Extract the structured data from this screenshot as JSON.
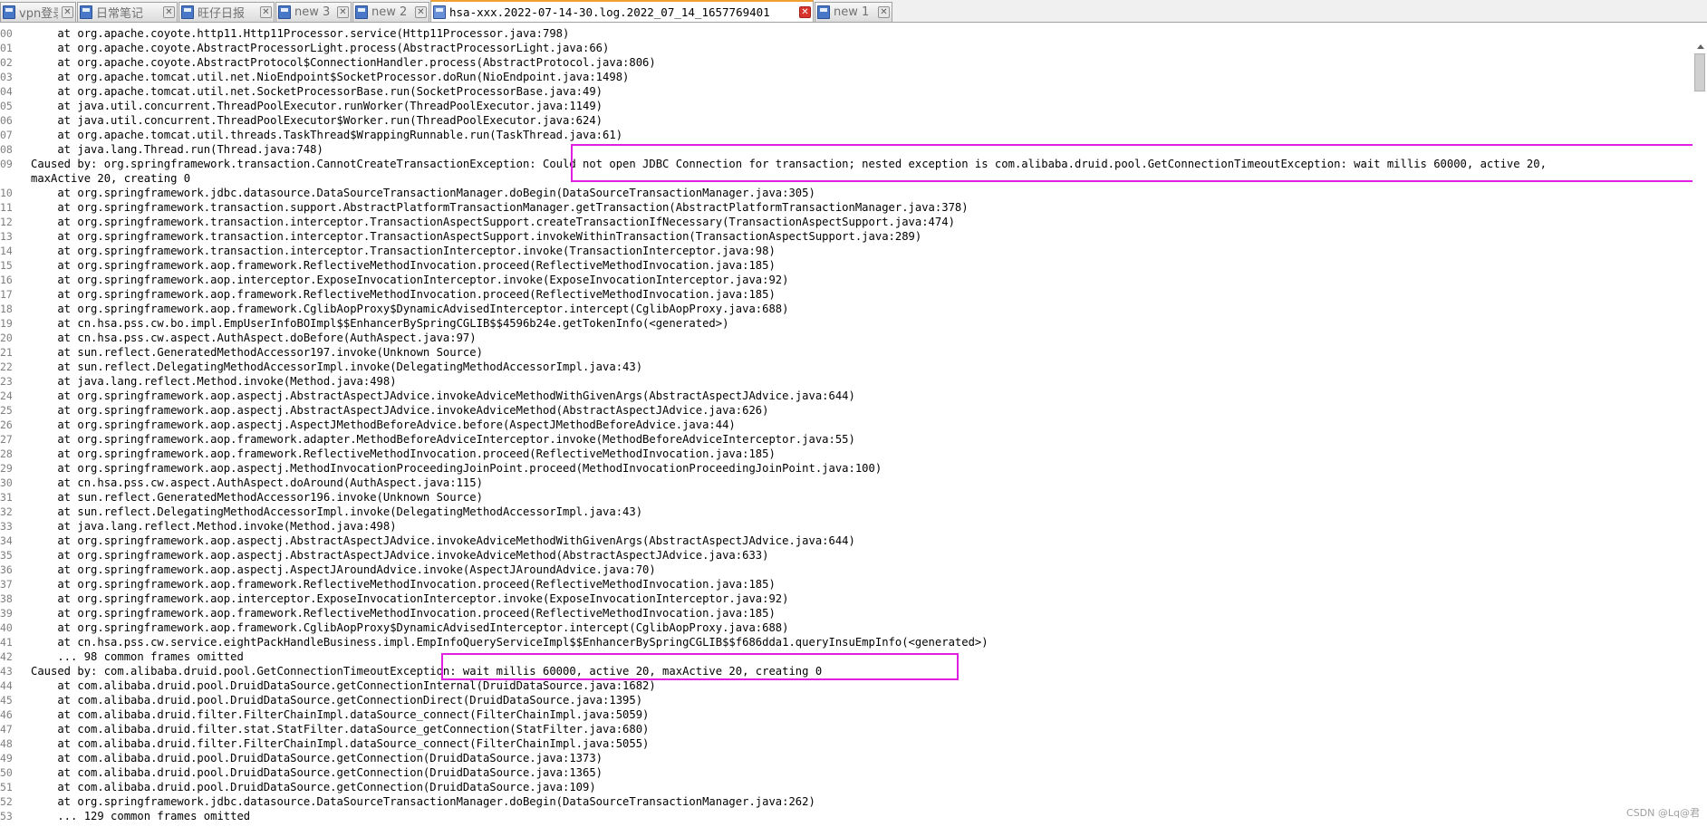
{
  "tabs": [
    {
      "label": "vpn登录",
      "active": false
    },
    {
      "label": "日常笔记",
      "active": false
    },
    {
      "label": "旺仔日报",
      "active": false
    },
    {
      "label": "new 3",
      "active": false
    },
    {
      "label": "new 2",
      "active": false
    },
    {
      "label": "hsa-xxx.2022-07-14-30.log.2022_07_14_1657769401",
      "active": true
    },
    {
      "label": "new 1",
      "active": false
    }
  ],
  "colors": {
    "highlight": "#e020e0",
    "active_tab_accent": "#f0a030"
  },
  "lines": [
    {
      "n": "00",
      "text": "    at org.apache.coyote.http11.Http11Processor.service(Http11Processor.java:798)"
    },
    {
      "n": "01",
      "text": "    at org.apache.coyote.AbstractProcessorLight.process(AbstractProcessorLight.java:66)"
    },
    {
      "n": "02",
      "text": "    at org.apache.coyote.AbstractProtocol$ConnectionHandler.process(AbstractProtocol.java:806)"
    },
    {
      "n": "03",
      "text": "    at org.apache.tomcat.util.net.NioEndpoint$SocketProcessor.doRun(NioEndpoint.java:1498)"
    },
    {
      "n": "04",
      "text": "    at org.apache.tomcat.util.net.SocketProcessorBase.run(SocketProcessorBase.java:49)"
    },
    {
      "n": "05",
      "text": "    at java.util.concurrent.ThreadPoolExecutor.runWorker(ThreadPoolExecutor.java:1149)"
    },
    {
      "n": "06",
      "text": "    at java.util.concurrent.ThreadPoolExecutor$Worker.run(ThreadPoolExecutor.java:624)"
    },
    {
      "n": "07",
      "text": "    at org.apache.tomcat.util.threads.TaskThread$WrappingRunnable.run(TaskThread.java:61)"
    },
    {
      "n": "08",
      "text": "    at java.lang.Thread.run(Thread.java:748)"
    },
    {
      "n": "09",
      "text": "Caused by: org.springframework.transaction.CannotCreateTransactionException: Could not open JDBC Connection for transaction; nested exception is com.alibaba.druid.pool.GetConnectionTimeoutException: wait millis 60000, active 20,"
    },
    {
      "n": "",
      "text": "maxActive 20, creating 0"
    },
    {
      "n": "10",
      "text": "    at org.springframework.jdbc.datasource.DataSourceTransactionManager.doBegin(DataSourceTransactionManager.java:305)"
    },
    {
      "n": "11",
      "text": "    at org.springframework.transaction.support.AbstractPlatformTransactionManager.getTransaction(AbstractPlatformTransactionManager.java:378)"
    },
    {
      "n": "12",
      "text": "    at org.springframework.transaction.interceptor.TransactionAspectSupport.createTransactionIfNecessary(TransactionAspectSupport.java:474)"
    },
    {
      "n": "13",
      "text": "    at org.springframework.transaction.interceptor.TransactionAspectSupport.invokeWithinTransaction(TransactionAspectSupport.java:289)"
    },
    {
      "n": "14",
      "text": "    at org.springframework.transaction.interceptor.TransactionInterceptor.invoke(TransactionInterceptor.java:98)"
    },
    {
      "n": "15",
      "text": "    at org.springframework.aop.framework.ReflectiveMethodInvocation.proceed(ReflectiveMethodInvocation.java:185)"
    },
    {
      "n": "16",
      "text": "    at org.springframework.aop.interceptor.ExposeInvocationInterceptor.invoke(ExposeInvocationInterceptor.java:92)"
    },
    {
      "n": "17",
      "text": "    at org.springframework.aop.framework.ReflectiveMethodInvocation.proceed(ReflectiveMethodInvocation.java:185)"
    },
    {
      "n": "18",
      "text": "    at org.springframework.aop.framework.CglibAopProxy$DynamicAdvisedInterceptor.intercept(CglibAopProxy.java:688)"
    },
    {
      "n": "19",
      "text": "    at cn.hsa.pss.cw.bo.impl.EmpUserInfoBOImpl$$EnhancerBySpringCGLIB$$4596b24e.getTokenInfo(<generated>)"
    },
    {
      "n": "20",
      "text": "    at cn.hsa.pss.cw.aspect.AuthAspect.doBefore(AuthAspect.java:97)"
    },
    {
      "n": "21",
      "text": "    at sun.reflect.GeneratedMethodAccessor197.invoke(Unknown Source)"
    },
    {
      "n": "22",
      "text": "    at sun.reflect.DelegatingMethodAccessorImpl.invoke(DelegatingMethodAccessorImpl.java:43)"
    },
    {
      "n": "23",
      "text": "    at java.lang.reflect.Method.invoke(Method.java:498)"
    },
    {
      "n": "24",
      "text": "    at org.springframework.aop.aspectj.AbstractAspectJAdvice.invokeAdviceMethodWithGivenArgs(AbstractAspectJAdvice.java:644)"
    },
    {
      "n": "25",
      "text": "    at org.springframework.aop.aspectj.AbstractAspectJAdvice.invokeAdviceMethod(AbstractAspectJAdvice.java:626)"
    },
    {
      "n": "26",
      "text": "    at org.springframework.aop.aspectj.AspectJMethodBeforeAdvice.before(AspectJMethodBeforeAdvice.java:44)"
    },
    {
      "n": "27",
      "text": "    at org.springframework.aop.framework.adapter.MethodBeforeAdviceInterceptor.invoke(MethodBeforeAdviceInterceptor.java:55)"
    },
    {
      "n": "28",
      "text": "    at org.springframework.aop.framework.ReflectiveMethodInvocation.proceed(ReflectiveMethodInvocation.java:185)"
    },
    {
      "n": "29",
      "text": "    at org.springframework.aop.aspectj.MethodInvocationProceedingJoinPoint.proceed(MethodInvocationProceedingJoinPoint.java:100)"
    },
    {
      "n": "30",
      "text": "    at cn.hsa.pss.cw.aspect.AuthAspect.doAround(AuthAspect.java:115)"
    },
    {
      "n": "31",
      "text": "    at sun.reflect.GeneratedMethodAccessor196.invoke(Unknown Source)"
    },
    {
      "n": "32",
      "text": "    at sun.reflect.DelegatingMethodAccessorImpl.invoke(DelegatingMethodAccessorImpl.java:43)"
    },
    {
      "n": "33",
      "text": "    at java.lang.reflect.Method.invoke(Method.java:498)"
    },
    {
      "n": "34",
      "text": "    at org.springframework.aop.aspectj.AbstractAspectJAdvice.invokeAdviceMethodWithGivenArgs(AbstractAspectJAdvice.java:644)"
    },
    {
      "n": "35",
      "text": "    at org.springframework.aop.aspectj.AbstractAspectJAdvice.invokeAdviceMethod(AbstractAspectJAdvice.java:633)"
    },
    {
      "n": "36",
      "text": "    at org.springframework.aop.aspectj.AspectJAroundAdvice.invoke(AspectJAroundAdvice.java:70)"
    },
    {
      "n": "37",
      "text": "    at org.springframework.aop.framework.ReflectiveMethodInvocation.proceed(ReflectiveMethodInvocation.java:185)"
    },
    {
      "n": "38",
      "text": "    at org.springframework.aop.interceptor.ExposeInvocationInterceptor.invoke(ExposeInvocationInterceptor.java:92)"
    },
    {
      "n": "39",
      "text": "    at org.springframework.aop.framework.ReflectiveMethodInvocation.proceed(ReflectiveMethodInvocation.java:185)"
    },
    {
      "n": "40",
      "text": "    at org.springframework.aop.framework.CglibAopProxy$DynamicAdvisedInterceptor.intercept(CglibAopProxy.java:688)"
    },
    {
      "n": "41",
      "text": "    at cn.hsa.pss.cw.service.eightPackHandleBusiness.impl.EmpInfoQueryServiceImpl$$EnhancerBySpringCGLIB$$f686dda1.queryInsuEmpInfo(<generated>)"
    },
    {
      "n": "42",
      "text": "    ... 98 common frames omitted"
    },
    {
      "n": "43",
      "text": "Caused by: com.alibaba.druid.pool.GetConnectionTimeoutException: wait millis 60000, active 20, maxActive 20, creating 0"
    },
    {
      "n": "44",
      "text": "    at com.alibaba.druid.pool.DruidDataSource.getConnectionInternal(DruidDataSource.java:1682)"
    },
    {
      "n": "45",
      "text": "    at com.alibaba.druid.pool.DruidDataSource.getConnectionDirect(DruidDataSource.java:1395)"
    },
    {
      "n": "46",
      "text": "    at com.alibaba.druid.filter.FilterChainImpl.dataSource_connect(FilterChainImpl.java:5059)"
    },
    {
      "n": "47",
      "text": "    at com.alibaba.druid.filter.stat.StatFilter.dataSource_getConnection(StatFilter.java:680)"
    },
    {
      "n": "48",
      "text": "    at com.alibaba.druid.filter.FilterChainImpl.dataSource_connect(FilterChainImpl.java:5055)"
    },
    {
      "n": "49",
      "text": "    at com.alibaba.druid.pool.DruidDataSource.getConnection(DruidDataSource.java:1373)"
    },
    {
      "n": "50",
      "text": "    at com.alibaba.druid.pool.DruidDataSource.getConnection(DruidDataSource.java:1365)"
    },
    {
      "n": "51",
      "text": "    at com.alibaba.druid.pool.DruidDataSource.getConnection(DruidDataSource.java:109)"
    },
    {
      "n": "52",
      "text": "    at org.springframework.jdbc.datasource.DataSourceTransactionManager.doBegin(DataSourceTransactionManager.java:262)"
    },
    {
      "n": "53",
      "text": "    ... 129 common frames omitted"
    }
  ],
  "watermark": "CSDN @Lq@君"
}
